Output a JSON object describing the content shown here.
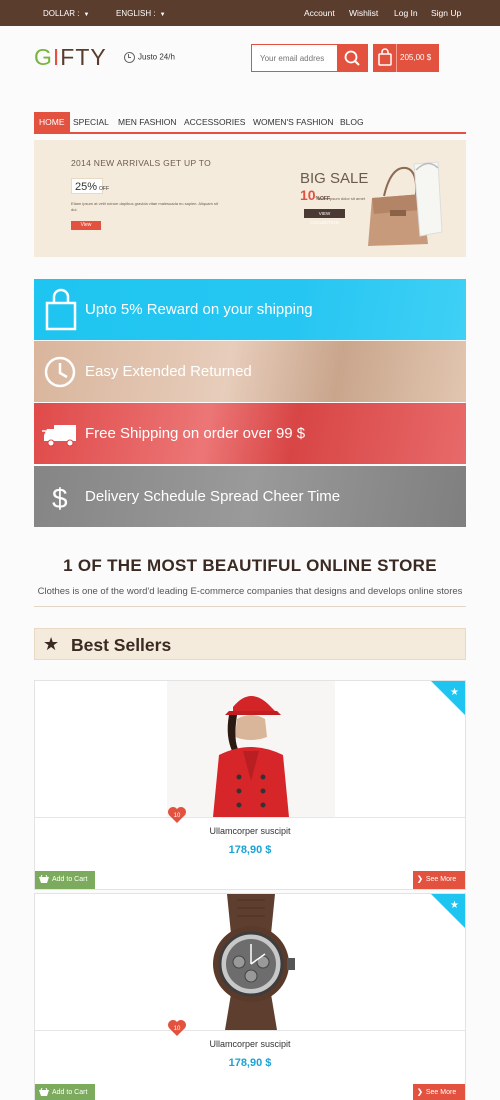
{
  "topbar": {
    "currency_label": "DOLLAR :",
    "language_label": "ENGLISH :",
    "links": [
      "Account",
      "Wishlist",
      "Log In",
      "Sign Up"
    ]
  },
  "header": {
    "logo": {
      "g": "G",
      "i": "I",
      "f": "F",
      "t": "T",
      "y": "Y"
    },
    "support_text": "Justo 24/h",
    "search_placeholder": "Your email addres",
    "cart_text": "205,00 $"
  },
  "nav": {
    "items": [
      "HOME",
      "SPECIAL",
      "MEN FASHION",
      "ACCESSORIES",
      "WOMEN'S FASHION",
      "BLOG"
    ],
    "active_index": 0
  },
  "banner": {
    "headline": "2014 NEW ARRIVALS GET UP TO",
    "percent": "25%",
    "percent_suffix": "OFF",
    "description": "Etiam ipsum at velit rutrum dapibus gravida vitae malesuada eu sapien. Aliquam sit dui.",
    "view_label": "View",
    "big_sale": "BIG SALE",
    "sale_percent": "10",
    "sale_off": "%OFF",
    "sale_sub": "lorem ipsum dolor sit amet",
    "collection_label": "VIEW COLLECTION"
  },
  "services": [
    {
      "label": "Upto 5% Reward on your shipping",
      "icon": "shopping-bag-icon"
    },
    {
      "label": "Easy Extended Returned",
      "icon": "clock-icon"
    },
    {
      "label": "Free Shipping on order over 99 $",
      "icon": "truck-icon"
    },
    {
      "label": "Delivery Schedule Spread Cheer Time",
      "icon": "dollar-icon"
    }
  ],
  "intro": {
    "title": "1 OF THE MOST BEAUTIFUL ONLINE STORE",
    "subtitle": "Clothes is one of the word'd leading E-commerce companies that designs and develops online stores"
  },
  "best_sellers": {
    "title": "Best Sellers",
    "products": [
      {
        "name": "Ullamcorper suscipit",
        "price": "178,90 $",
        "likes": "10",
        "add_label": "Add to Cart",
        "more_label": "See More",
        "image": "red-coat-photo"
      },
      {
        "name": "Ullamcorper suscipit",
        "price": "178,90 $",
        "likes": "10",
        "add_label": "Add to Cart",
        "more_label": "See More",
        "image": "watch-photo"
      }
    ]
  },
  "colors": {
    "brand_brown": "#5b3d2e",
    "accent_red": "#e2523f",
    "logo_green": "#78b53e",
    "price_blue": "#1aa3d6",
    "cart_green": "#7dab5e"
  }
}
